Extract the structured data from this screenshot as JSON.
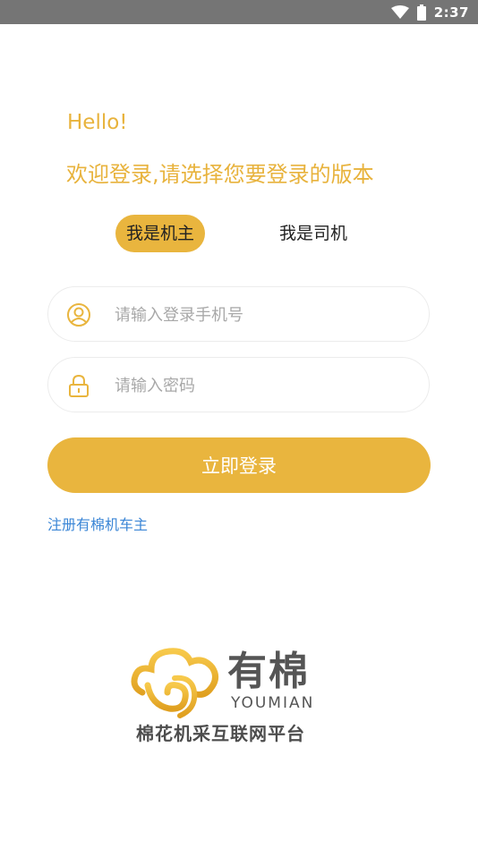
{
  "status_bar": {
    "time": "2:37",
    "icons": [
      "wifi-icon",
      "battery-icon"
    ]
  },
  "greeting": {
    "hello": "Hello!",
    "welcome": "欢迎登录,请选择您要登录的版本"
  },
  "role_tabs": [
    {
      "label": "我是机主",
      "active": true
    },
    {
      "label": "我是司机",
      "active": false
    }
  ],
  "form": {
    "phone_placeholder": "请输入登录手机号",
    "phone_value": "",
    "phone_icon": "user-icon",
    "password_placeholder": "请输入密码",
    "password_value": "",
    "password_icon": "lock-icon",
    "login_label": "立即登录",
    "register_label": "注册有棉机车主"
  },
  "brand": {
    "name": "有棉",
    "name_en": "YOUMIAN",
    "slogan": "棉花机采互联网平台",
    "logo_icon": "cotton-cloud-logo-icon"
  },
  "colors": {
    "accent": "#e9b53e",
    "link": "#3b86d6",
    "status_bar": "#757575"
  }
}
